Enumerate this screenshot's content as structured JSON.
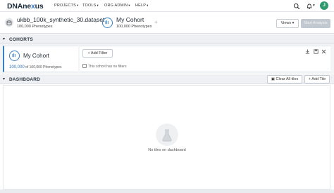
{
  "topnav": {
    "logo_main": "DNAne",
    "logo_accent": "x",
    "logo_end": "us",
    "items": [
      {
        "label": "PROJECTS"
      },
      {
        "label": "TOOLS"
      },
      {
        "label": "ORG ADMIN"
      },
      {
        "label": "HELP"
      }
    ],
    "avatar_initial": "J",
    "icons": [
      "search-icon",
      "bell-icon",
      "user-icon"
    ]
  },
  "dataset": {
    "name": "ukbb_100k_synthetic_30.dataset",
    "subtitle": "100,000 Phenotypes"
  },
  "cohort_tab": {
    "name": "My Cohort",
    "subtitle": "100,000 Phenotypes",
    "add_symbol": "+"
  },
  "header_actions": {
    "views_label": "Views",
    "start_label": "Start Analysis"
  },
  "cohorts_section": {
    "title": "COHORTS",
    "card": {
      "name": "My Cohort",
      "count": "100,000",
      "count_suffix": "of 100,000 Phenotypes"
    },
    "add_filter_label": "+ Add Filter",
    "no_filters_text": "This cohort has no filters"
  },
  "dashboard_section": {
    "title": "DASHBOARD",
    "clear_label": "Clear All tiles",
    "add_tile_label": "+ Add Tile",
    "empty_text": "No tiles on dashboard"
  },
  "colors": {
    "accent": "#3a7fc4",
    "avatar": "#2f9a6d",
    "disabled_button": "#c2c8cf"
  }
}
